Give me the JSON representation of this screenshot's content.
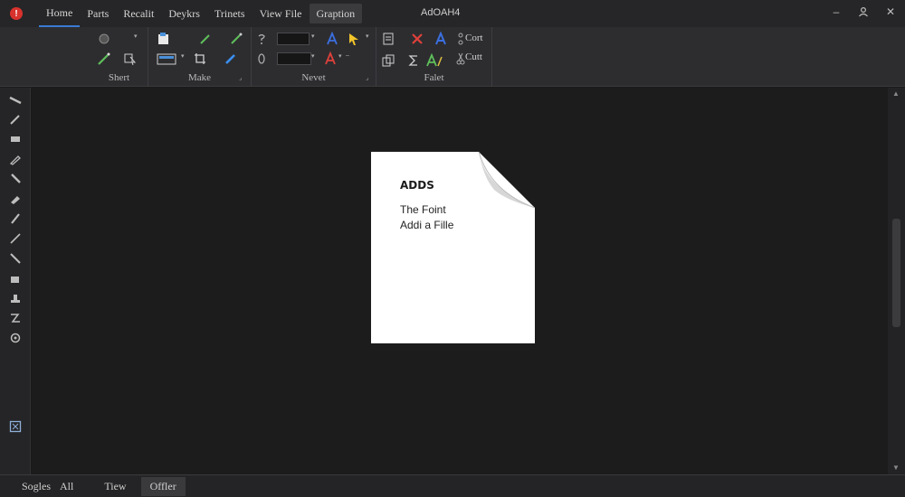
{
  "menu": {
    "items": [
      "Home",
      "Parts",
      "Recalit",
      "Deykrs",
      "Trinets",
      "View File",
      "Graption"
    ],
    "home_index": 0,
    "active_index": 6
  },
  "window": {
    "title": "AdOAH4"
  },
  "ribbon": {
    "groups": {
      "shert": "Shert",
      "make": "Make",
      "nevet": "Nevet",
      "falet": "Falet"
    },
    "text_buttons": {
      "cort": "Cort",
      "cutt": "Cutt"
    }
  },
  "document": {
    "title": "ADDS",
    "lines": [
      "The Foint",
      "Addi a Fille"
    ]
  },
  "bottom_tabs": {
    "items": [
      "Sogles",
      "All",
      "Tiew",
      "Offler"
    ],
    "active_index": 3
  },
  "colors": {
    "accent": "#3a7bd5",
    "logo": "#d8322c",
    "red_x": "#e0403a",
    "blue_a": "#3b6fe0",
    "yellow_cursor": "#f2c42a",
    "green": "#5fbf5a"
  }
}
